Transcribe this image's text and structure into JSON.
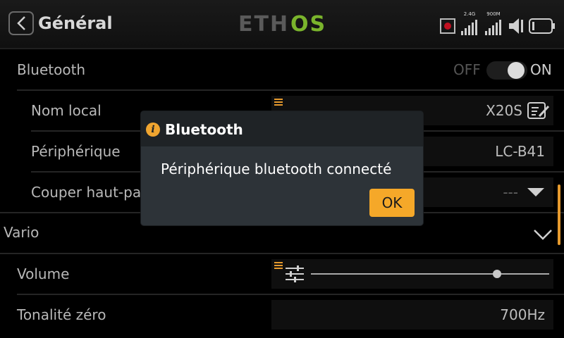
{
  "header": {
    "title": "Général",
    "logo_text": "ETHOS",
    "status": {
      "signal_1_label": "2.4G",
      "signal_2_label": "900M"
    }
  },
  "rows": {
    "bluetooth": {
      "label": "Bluetooth",
      "off_label": "OFF",
      "on_label": "ON",
      "state": "on"
    },
    "nom_local": {
      "label": "Nom local",
      "value": "X20S"
    },
    "peripherique": {
      "label": "Périphérique",
      "value": "LC-B41"
    },
    "couper": {
      "label": "Couper haut-pa",
      "value": "---"
    },
    "vario": {
      "label": "Vario"
    },
    "volume": {
      "label": "Volume",
      "level": 0.78
    },
    "tonalite": {
      "label": "Tonalité zéro",
      "value": "700Hz"
    }
  },
  "dialog": {
    "title": "Bluetooth",
    "message": "Périphérique bluetooth connecté",
    "ok_label": "OK"
  },
  "colors": {
    "accent": "#f5a829",
    "logo_green": "#7ab42c",
    "logo_gray": "#5a5a5a"
  }
}
